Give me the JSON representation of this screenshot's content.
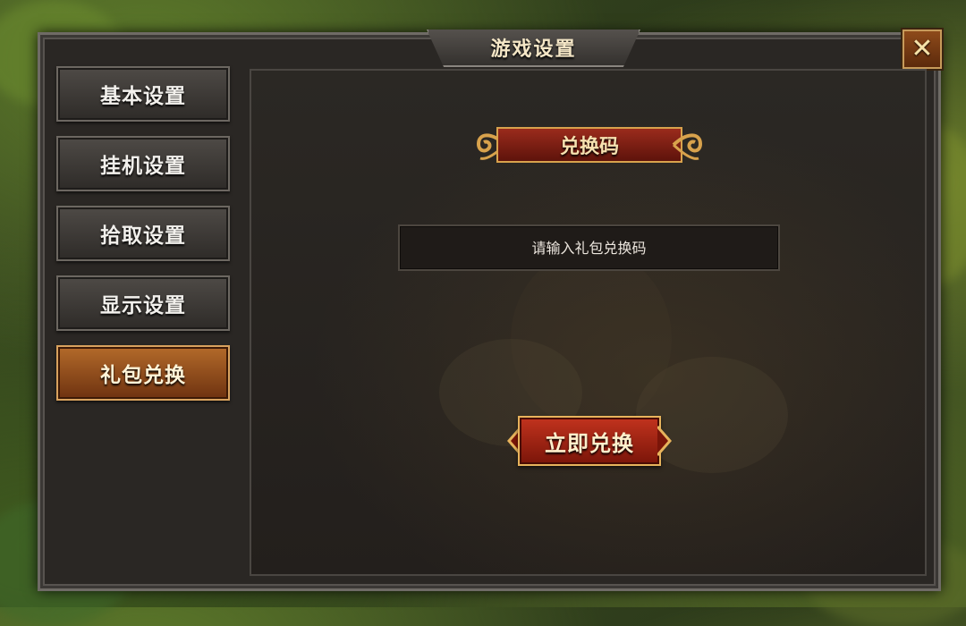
{
  "dialog": {
    "title": "游戏设置",
    "close_label": "✕"
  },
  "sidebar": {
    "items": [
      {
        "label": "基本设置",
        "active": false
      },
      {
        "label": "挂机设置",
        "active": false
      },
      {
        "label": "拾取设置",
        "active": false
      },
      {
        "label": "显示设置",
        "active": false
      },
      {
        "label": "礼包兑换",
        "active": true
      }
    ]
  },
  "redeem_panel": {
    "header": "兑换码",
    "input_placeholder": "请输入礼包兑换码",
    "input_value": "",
    "submit_label": "立即兑换"
  },
  "colors": {
    "accent_gold": "#d8a24c",
    "active_tab": "#b36a2a",
    "button_red": "#c2331e"
  }
}
